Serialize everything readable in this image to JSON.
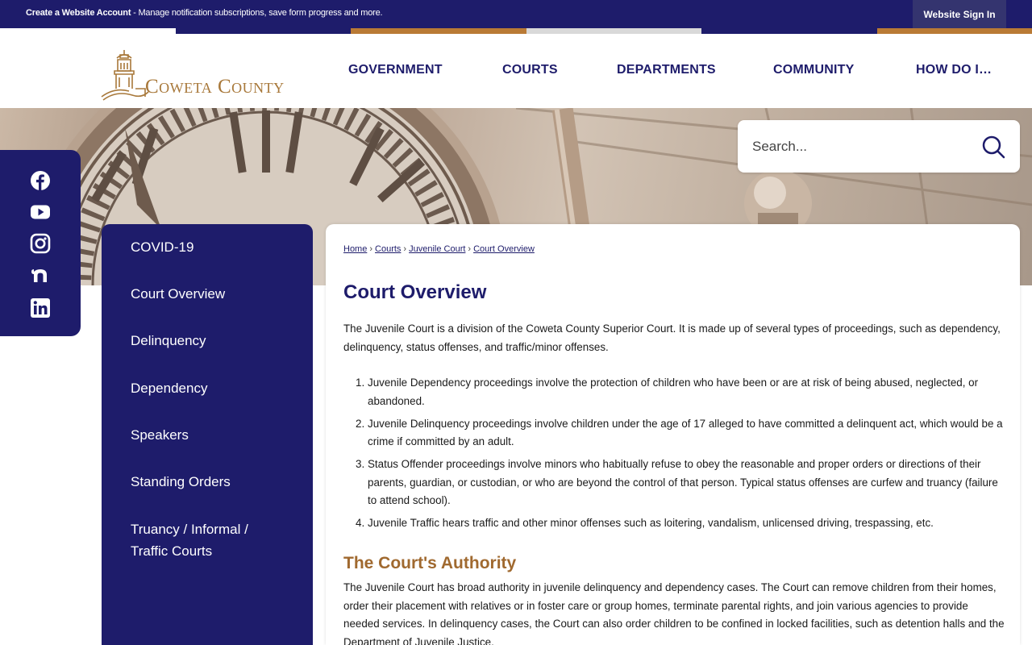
{
  "topbar": {
    "create_account_label": "Create a Website Account",
    "create_account_desc": " - Manage notification subscriptions, save form progress and more.",
    "sign_in_label": "Website Sign In"
  },
  "stripes": {
    "colors": [
      "#ffffff",
      "#1e1c6b",
      "#b97a35",
      "#d9d9d9",
      "#1e1c6b",
      "#b97a35"
    ]
  },
  "logo": {
    "text": "Coweta County",
    "icon": "courthouse-logo-icon",
    "color": "#a8783a"
  },
  "nav": {
    "items": [
      {
        "label": "GOVERNMENT"
      },
      {
        "label": "COURTS"
      },
      {
        "label": "DEPARTMENTS"
      },
      {
        "label": "COMMUNITY"
      },
      {
        "label": "HOW DO I…"
      }
    ]
  },
  "search": {
    "placeholder": "Search...",
    "icon": "search-icon"
  },
  "social": {
    "icons": [
      "facebook-icon",
      "youtube-icon",
      "instagram-icon",
      "nextdoor-icon",
      "linkedin-icon"
    ]
  },
  "sidenav": {
    "items": [
      {
        "label": "COVID-19"
      },
      {
        "label": "Court Overview"
      },
      {
        "label": "Delinquency"
      },
      {
        "label": "Dependency"
      },
      {
        "label": "Speakers"
      },
      {
        "label": "Standing Orders"
      },
      {
        "label": "Truancy / Informal / Traffic Courts"
      }
    ]
  },
  "breadcrumb": {
    "items": [
      "Home",
      "Courts",
      "Juvenile Court",
      "Court Overview"
    ],
    "separator": "›"
  },
  "main": {
    "title": "Court Overview",
    "intro": "The Juvenile Court is a division of the Coweta County Superior Court. It is made up of several types of proceedings, such as dependency, delinquency, status offenses, and traffic/minor offenses.",
    "list": [
      {
        "num": "1.",
        "text": "Juvenile Dependency proceedings involve the protection of children who have been or are at risk of being abused, neglected, or abandoned."
      },
      {
        "num": "2.",
        "text": "Juvenile Delinquency proceedings involve children under the age of 17 alleged to have committed a delinquent act, which would be a crime if committed by an adult."
      },
      {
        "num": "3.",
        "text": "Status Offender proceedings involve minors who habitually refuse to obey the reasonable and proper orders or directions of their parents, guardian, or custodian, or who are beyond the control of that person. Typical status offenses are curfew and truancy (failure to attend school)."
      },
      {
        "num": "4.",
        "text": "Juvenile Traffic hears traffic and other minor offenses such as loitering, vandalism, unlicensed driving, trespassing, etc."
      }
    ],
    "authority_title": "The Court's Authority",
    "authority_text": "The Juvenile Court has broad authority in juvenile delinquency and dependency cases. The Court can remove children from their homes, order their placement with relatives or in foster care or group homes, terminate parental rights, and join various agencies to provide needed services. In delinquency cases, the Court can also order children to be confined in locked facilities, such as detention halls and the Department of Juvenile Justice."
  },
  "colors": {
    "navy": "#1e1c6b",
    "gold": "#a0692f"
  }
}
